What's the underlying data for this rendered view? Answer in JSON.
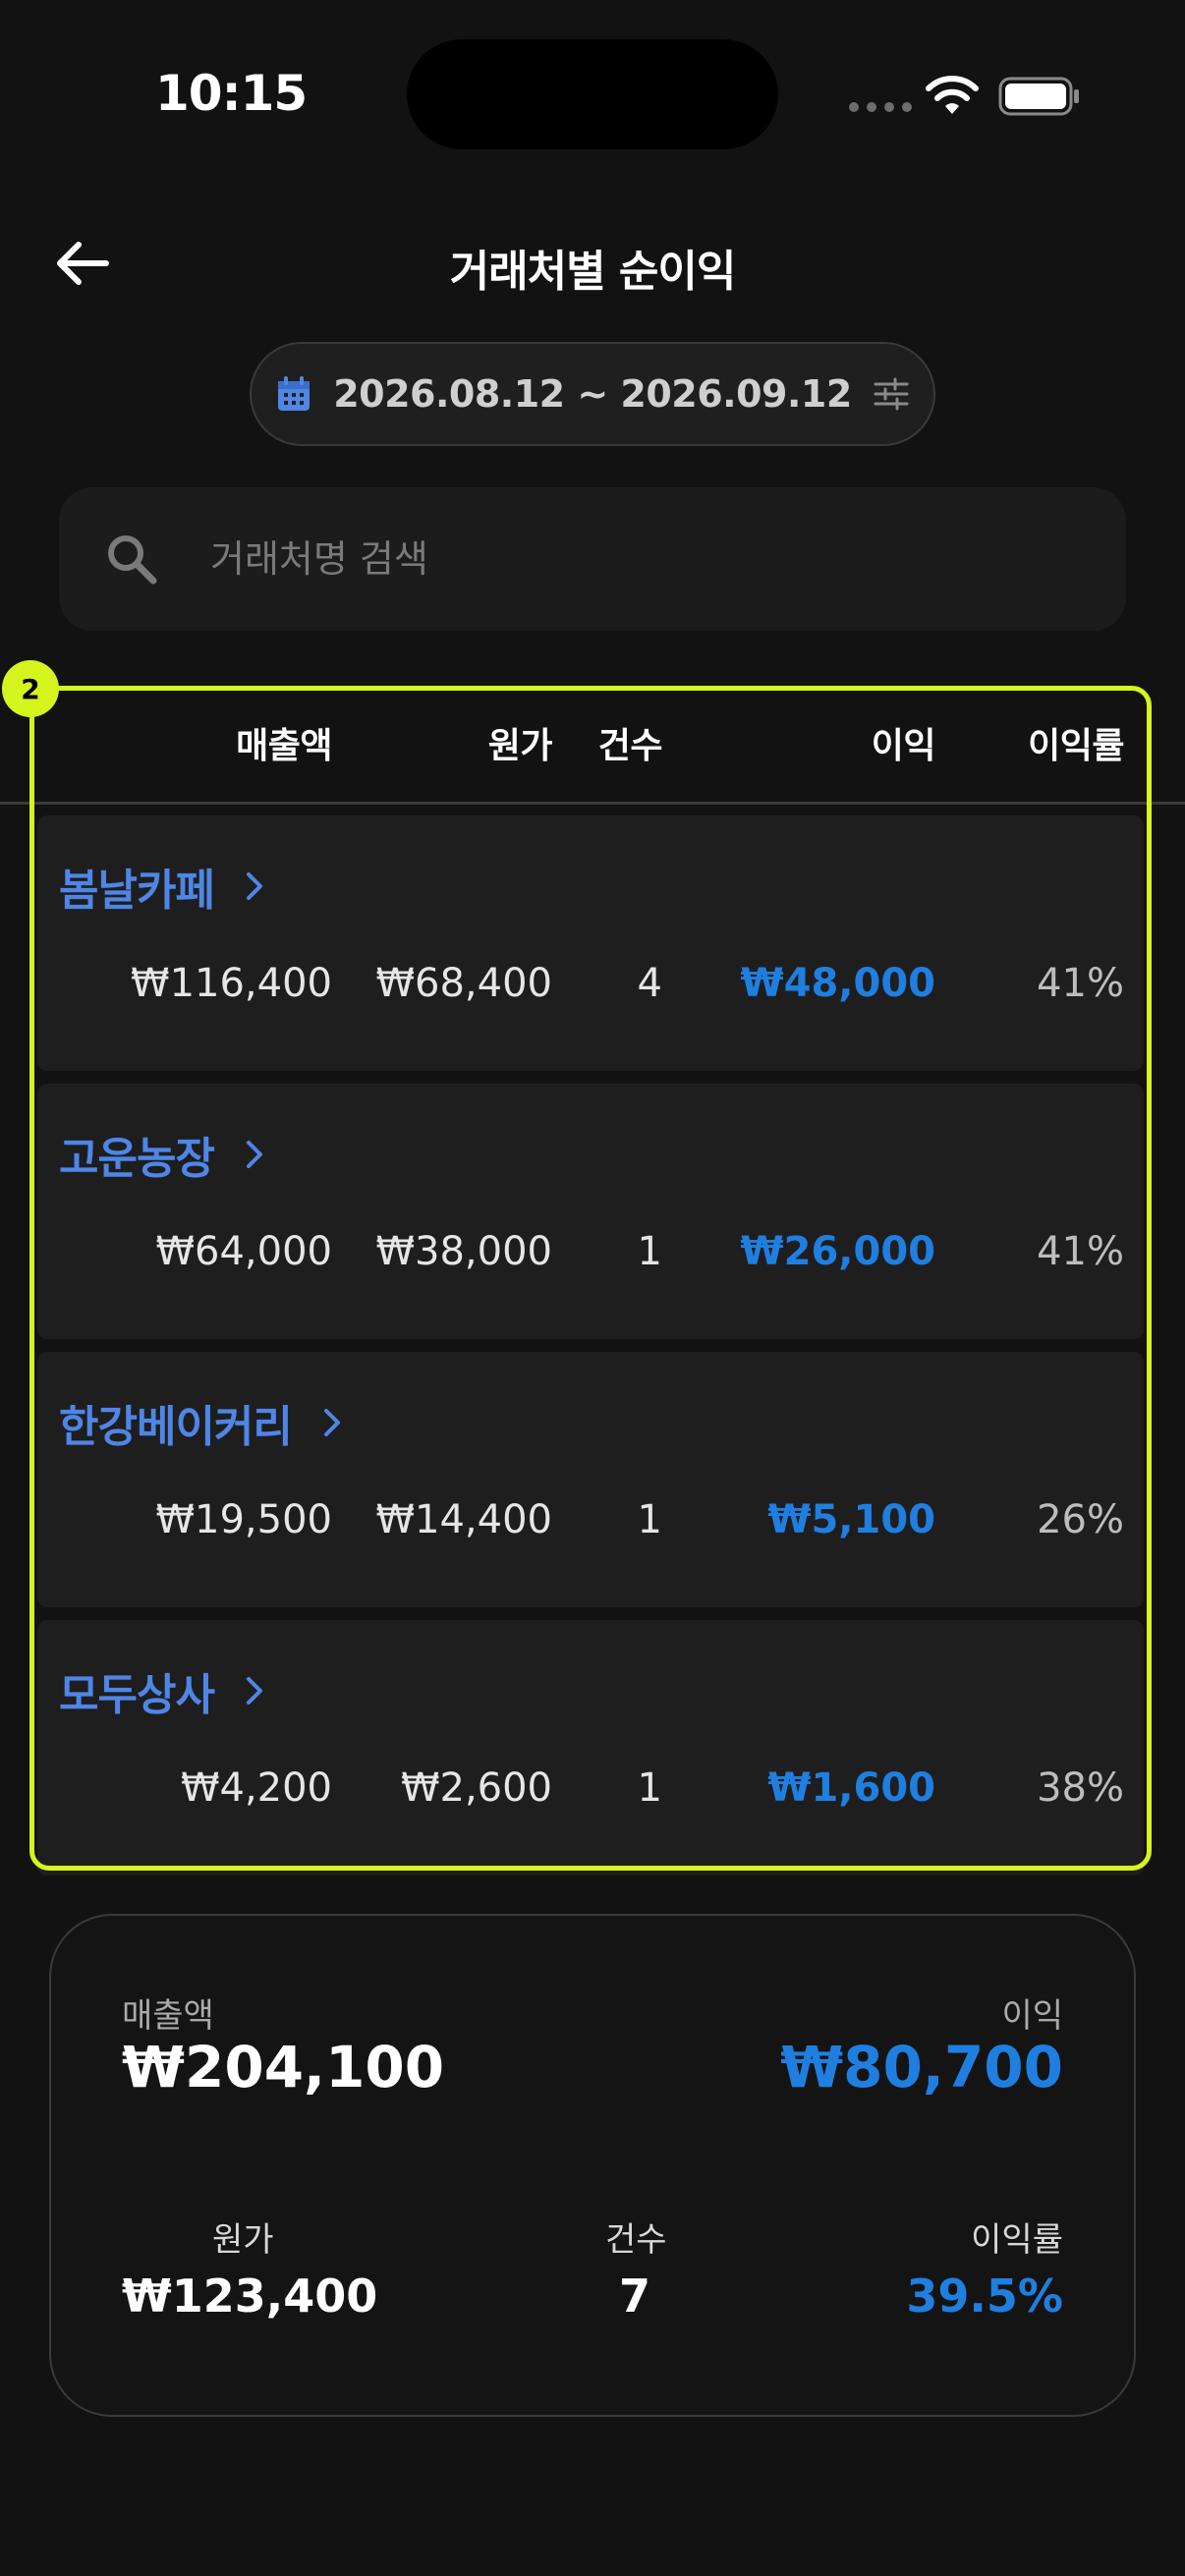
{
  "status": {
    "time": "10:15"
  },
  "header": {
    "title": "거래처별 순이익"
  },
  "date_range": {
    "label": "2026.08.12 ~ 2026.09.12"
  },
  "search": {
    "placeholder": "거래처명 검색",
    "value": ""
  },
  "highlight": {
    "badge": "2"
  },
  "table": {
    "columns": [
      "매출액",
      "원가",
      "건수",
      "이익",
      "이익률"
    ],
    "rows": [
      {
        "name": "봄날카페",
        "sales": "₩116,400",
        "cost": "₩68,400",
        "count": "4",
        "profit": "₩48,000",
        "rate": "41%"
      },
      {
        "name": "고운농장",
        "sales": "₩64,000",
        "cost": "₩38,000",
        "count": "1",
        "profit": "₩26,000",
        "rate": "41%"
      },
      {
        "name": "한강베이커리",
        "sales": "₩19,500",
        "cost": "₩14,400",
        "count": "1",
        "profit": "₩5,100",
        "rate": "26%"
      },
      {
        "name": "모두상사",
        "sales": "₩4,200",
        "cost": "₩2,600",
        "count": "1",
        "profit": "₩1,600",
        "rate": "38%"
      }
    ]
  },
  "summary": {
    "sales_label": "매출액",
    "sales_value": "₩204,100",
    "profit_label": "이익",
    "profit_value": "₩80,700",
    "cost_label": "원가",
    "cost_value": "₩123,400",
    "count_label": "건수",
    "count_value": "7",
    "rate_label": "이익률",
    "rate_value": "39.5%"
  },
  "colors": {
    "accent_blue": "#1f7fe0",
    "name_blue": "#4f86e6",
    "highlight": "#d6f41e",
    "background": "#121212"
  },
  "icons": [
    "back-arrow-icon",
    "calendar-icon",
    "filter-sliders-icon",
    "search-icon",
    "chevron-right-icon",
    "wifi-icon",
    "battery-icon"
  ]
}
